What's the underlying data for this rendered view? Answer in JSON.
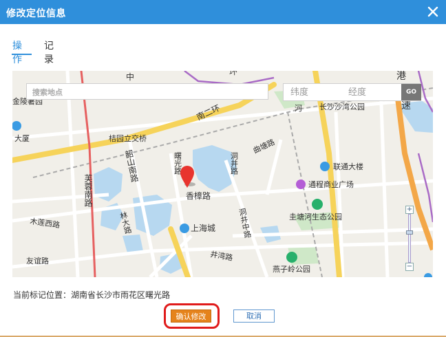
{
  "dialog": {
    "title": "修改定位信息"
  },
  "tabs": [
    {
      "label": "操作",
      "active": true
    },
    {
      "label": "记录",
      "active": false
    }
  ],
  "map": {
    "search_placeholder": "搜索地点",
    "lat_placeholder": "纬度",
    "lng_placeholder": "经度",
    "go_label": "GO",
    "zoom_in": "+",
    "zoom_out": "−",
    "labels": {
      "l1": "中",
      "l2": "环",
      "l3": "港",
      "l4": "速",
      "l5": "金陵暑园",
      "l6": "大厦",
      "l7": "桔园立交桥",
      "l8": "南二环",
      "l9": "长沙沙湾公园",
      "l10": "河",
      "l11": "芙蓉南路",
      "l12": "韶山南路",
      "l13": "曙光路",
      "l14": "洞井路",
      "l15": "曲塘路",
      "l16": "联通大楼",
      "l17": "通程商业广场",
      "l18": "香樟路",
      "l19": "木莲西路",
      "l20": "林大路",
      "l21": "上海城",
      "l22": "洞井中路",
      "l23": "圭塘河生态公园",
      "l24": "友谊路",
      "l25": "井湾路",
      "l26": "燕子岭公园"
    }
  },
  "address": {
    "text": "当前标记位置：湖南省长沙市雨花区曙光路"
  },
  "buttons": {
    "confirm": "确认修改",
    "cancel": "取消"
  },
  "colors": {
    "accent": "#2f8fdb",
    "confirm": "#e5831c",
    "highlight": "#e01b1b"
  }
}
